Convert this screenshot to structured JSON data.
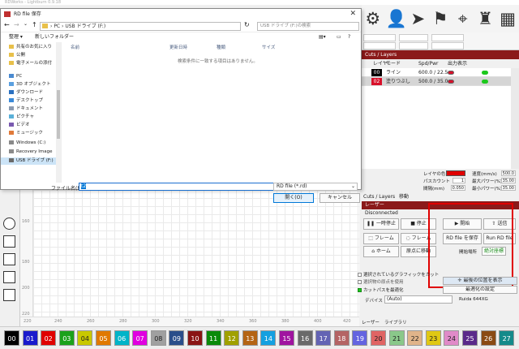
{
  "app": {
    "title": "RDWorks - Lightburn 0.9.18"
  },
  "toolbar": {
    "icons": [
      "robot-icon",
      "person-icon",
      "send-icon",
      "user-switch-icon",
      "crosshair-icon",
      "organize-icon",
      "grid-icon"
    ]
  },
  "layers": {
    "panel_title": "Cuts / Layers",
    "columns": {
      "layer": "レイヤ",
      "mode": "モード",
      "spd_pwr": "Spd/Pwr",
      "output": "出力",
      "show": "表示"
    },
    "rows": [
      {
        "num": "00",
        "color": "#000000",
        "mode": "ライン",
        "spd_pwr": "600.0 / 22.5"
      },
      {
        "num": "02",
        "color": "#d8102a",
        "mode": "塗りつぶし",
        "spd_pwr": "500.0 / 35.0"
      }
    ]
  },
  "props": {
    "layer_color_label": "レイヤの色",
    "layer_color": "#e00000",
    "speed_label": "速度(mm/s)",
    "speed": "500.0",
    "pass_label": "パスカウント",
    "pass": "1",
    "max_power_label": "最大パワー(%)",
    "max_power": "35.00",
    "interval_label": "間隔(mm)",
    "interval": "0.050",
    "min_power_label": "最小パワー(%)",
    "min_power": "35.00"
  },
  "tabs": [
    "Cuts / Layers",
    "移動"
  ],
  "laser": {
    "panel_title": "レーザー",
    "status": "Disconnected",
    "buttons": {
      "pause": "一時停止",
      "stop": "停止",
      "start": "開始",
      "send": "送信",
      "frame": "フレーム",
      "frame2": "フレーム",
      "save_rd": "RD file を保存",
      "run_rd": "Run RD file",
      "home": "ホーム",
      "goto_origin": "原点に移動"
    },
    "start_from_label": "開始場所",
    "start_from_value": "絶対座標",
    "checks": {
      "cut_selected": "選択されているグラフィックをカット",
      "use_selection_origin": "選択物の原点を使用",
      "optimize": "カットパスを最適化",
      "show_last_position": "最後の位置を表示",
      "optimize_settings": "最適化の設定"
    },
    "device_label": "デバイス",
    "device_value": "(Auto)",
    "device_model": "Ruida 644XG",
    "bottom_tabs": [
      "レーザー",
      "ライブラリ"
    ]
  },
  "canvas": {
    "vruler_labels": [
      "160",
      "180",
      "200",
      "220"
    ],
    "hruler_labels": [
      "220",
      "240",
      "260",
      "280",
      "300",
      "320",
      "340",
      "360",
      "380",
      "400",
      "420"
    ]
  },
  "palette": [
    {
      "label": "00",
      "color": "#000000"
    },
    {
      "label": "01",
      "color": "#1a1acc"
    },
    {
      "label": "02",
      "color": "#e00000"
    },
    {
      "label": "03",
      "color": "#1aa11a"
    },
    {
      "label": "04",
      "color": "#c8c800"
    },
    {
      "label": "05",
      "color": "#e07800"
    },
    {
      "label": "06",
      "color": "#00b4c8"
    },
    {
      "label": "07",
      "color": "#e000e0"
    },
    {
      "label": "08",
      "color": "#a0a0a0"
    },
    {
      "label": "09",
      "color": "#2a4e8a"
    },
    {
      "label": "10",
      "color": "#8a1414"
    },
    {
      "label": "11",
      "color": "#0a8a0a"
    },
    {
      "label": "12",
      "color": "#a0a000"
    },
    {
      "label": "13",
      "color": "#b46414"
    },
    {
      "label": "14",
      "color": "#14a0e0"
    },
    {
      "label": "15",
      "color": "#a014a0"
    },
    {
      "label": "16",
      "color": "#6a6a6a"
    },
    {
      "label": "17",
      "color": "#6464b4"
    },
    {
      "label": "18",
      "color": "#b46464"
    },
    {
      "label": "19",
      "color": "#6464e0"
    },
    {
      "label": "20",
      "color": "#e06464"
    },
    {
      "label": "21",
      "color": "#8ac88a"
    },
    {
      "label": "22",
      "color": "#e0b48a"
    },
    {
      "label": "23",
      "color": "#e0c814"
    },
    {
      "label": "24",
      "color": "#e08ac8"
    },
    {
      "label": "25",
      "color": "#5a2a8a"
    },
    {
      "label": "26",
      "color": "#8a4a14"
    },
    {
      "label": "27",
      "color": "#148a8a"
    }
  ],
  "dialog": {
    "title": "RD file 保存",
    "path": [
      "PC",
      "USB ドライブ (F:)"
    ],
    "search_placeholder": "USB ドライブ (F:)の検索",
    "organize": "整理",
    "new_folder": "新しいフォルダー",
    "columns": {
      "name": "名前",
      "date": "更新日時",
      "type": "種類",
      "size": "サイズ"
    },
    "empty_message": "検索条件に一致する項目はありません。",
    "nav_items": [
      {
        "label": "共有のお気に入り",
        "icon": "folder-icon"
      },
      {
        "label": "公開",
        "icon": "folder-icon"
      },
      {
        "label": "電子メールの添付",
        "icon": "folder-icon"
      },
      {
        "label": "PC",
        "icon": "pc-icon"
      },
      {
        "label": "3D オブジェクト",
        "icon": "3d-icon"
      },
      {
        "label": "ダウンロード",
        "icon": "download-icon"
      },
      {
        "label": "デスクトップ",
        "icon": "desktop-icon"
      },
      {
        "label": "ドキュメント",
        "icon": "document-icon"
      },
      {
        "label": "ピクチャ",
        "icon": "picture-icon"
      },
      {
        "label": "ビデオ",
        "icon": "video-icon"
      },
      {
        "label": "ミュージック",
        "icon": "music-icon"
      },
      {
        "label": "Windows (C:)",
        "icon": "drive-icon"
      },
      {
        "label": "Recovery Image",
        "icon": "drive-icon"
      },
      {
        "label": "USB ドライブ (F:)",
        "icon": "usb-icon"
      }
    ],
    "filename_label": "ファイル名(N):",
    "filename_value": "t2",
    "filetype": "RD file (*.rd)",
    "open_button": "開く(O)",
    "cancel_button": "キャンセル"
  }
}
